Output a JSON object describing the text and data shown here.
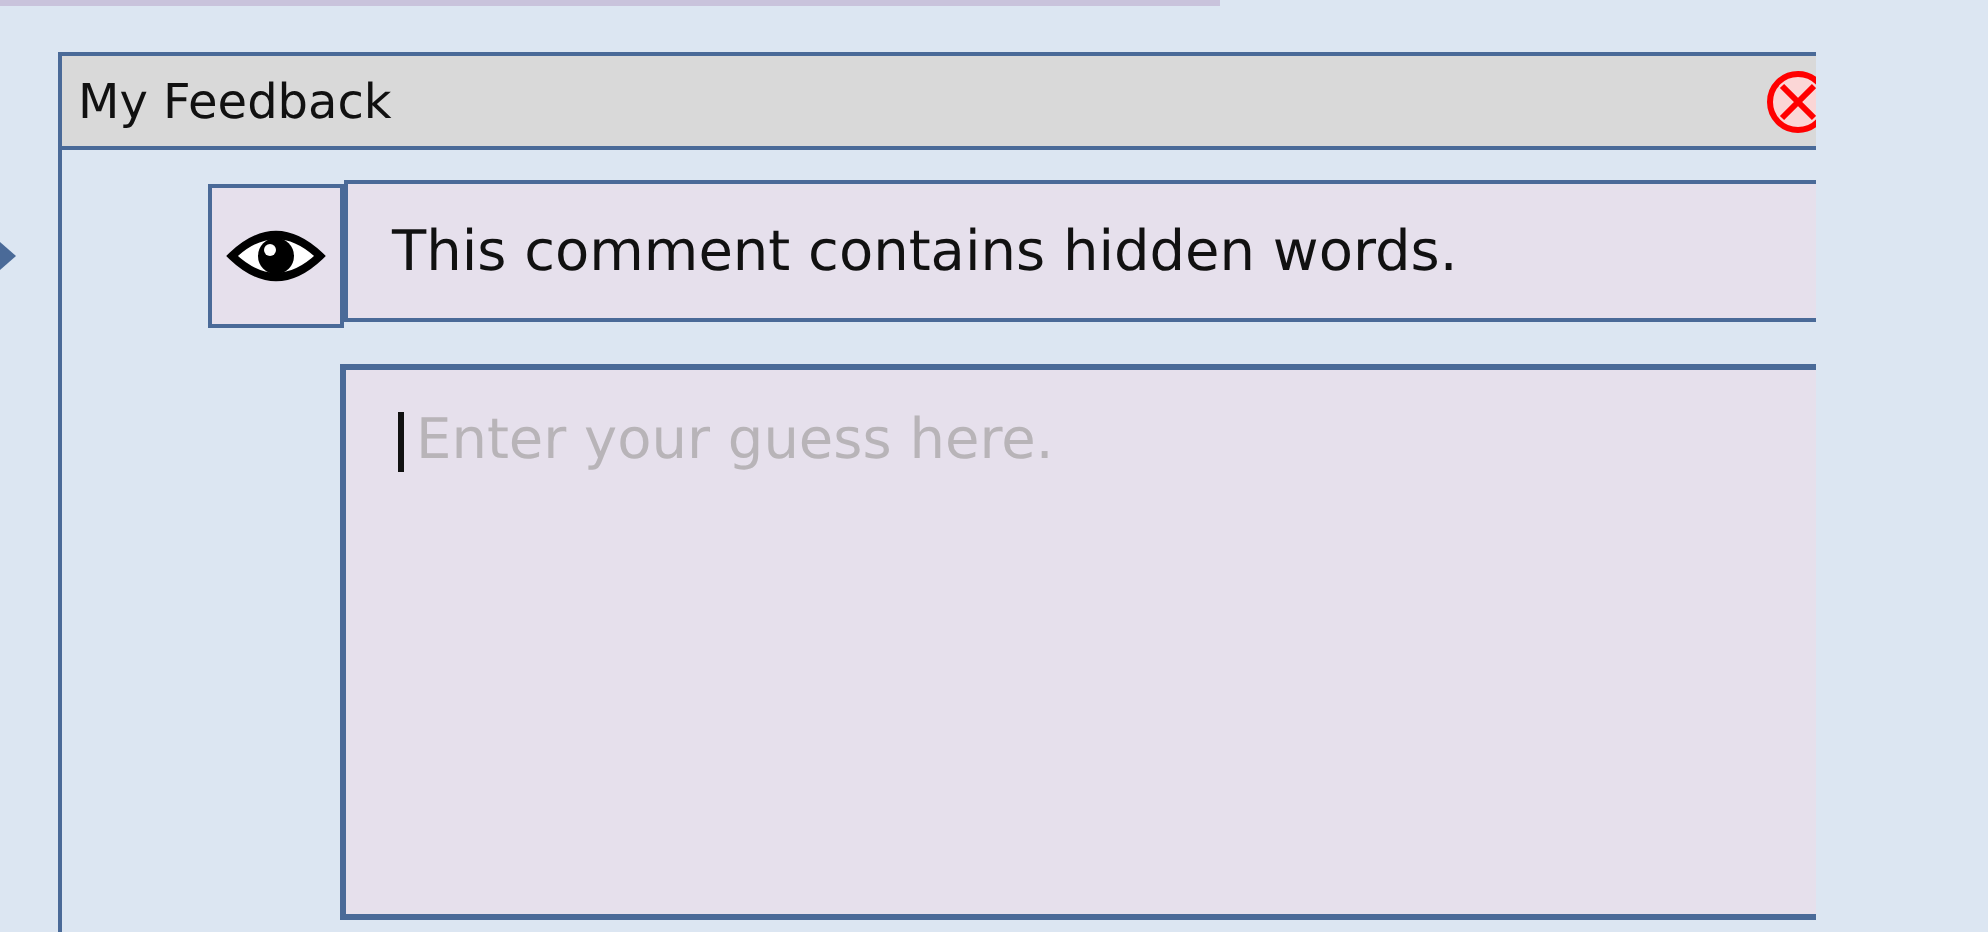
{
  "panel": {
    "title": "My Feedback"
  },
  "comment": {
    "text": "This comment contains hidden words.",
    "revealed": false
  },
  "guess": {
    "placeholder": "Enter your guess here.",
    "focused": true
  }
}
